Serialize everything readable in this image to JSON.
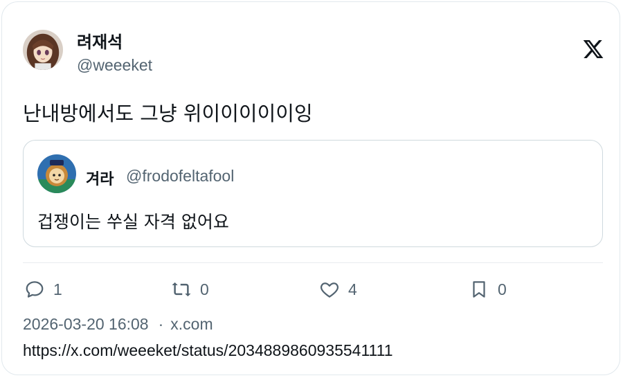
{
  "author": {
    "display_name": "려재석",
    "handle": "@weeeket",
    "avatar": "anime-girl-avatar"
  },
  "tweet": {
    "text": "난내방에서도 그냥 위이이이이이잉"
  },
  "quoted": {
    "display_name": "겨라",
    "handle": "@frodofeltafool",
    "text": "겁쟁이는 쑤실 자격 없어요",
    "avatar": "cartoon-lion-avatar"
  },
  "actions": {
    "reply_count": "1",
    "retweet_count": "0",
    "like_count": "4",
    "bookmark_count": "0"
  },
  "meta": {
    "timestamp": "2026-03-20 16:08",
    "separator": "·",
    "source": "x.com",
    "url": "https://x.com/weeeket/status/2034889860935541111"
  },
  "icons": {
    "logo": "x-logo-icon",
    "reply": "reply-icon",
    "retweet": "retweet-icon",
    "like": "heart-icon",
    "bookmark": "bookmark-icon"
  },
  "colors": {
    "text": "#0f1419",
    "secondary": "#536471",
    "border": "#cfd9de"
  }
}
